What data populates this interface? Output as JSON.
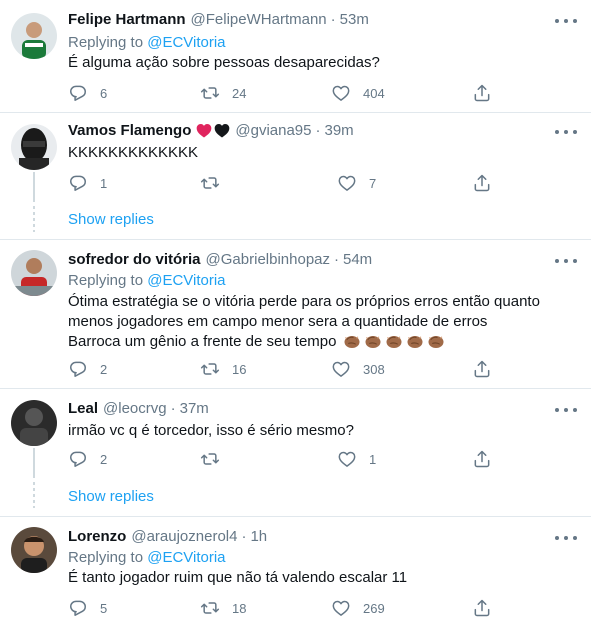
{
  "tweets": [
    {
      "name": "Felipe Hartmann",
      "handle": "@FelipeWHartmann",
      "time": "53m",
      "replying_prefix": "Replying to",
      "replying_to": "@ECVitoria",
      "text_lines": [
        "É alguma ação sobre pessoas desaparecidas?"
      ],
      "replies": "6",
      "retweets": "24",
      "likes": "404"
    },
    {
      "name": "Vamos Flamengo",
      "handle": "@gviana95",
      "time": "39m",
      "text_lines": [
        "KKKKKKKKKKKKK"
      ],
      "replies": "1",
      "retweets": "",
      "likes": "7",
      "show_replies": "Show replies"
    },
    {
      "name": "sofredor do vitória",
      "handle": "@Gabrielbinhopaz",
      "time": "54m",
      "replying_prefix": "Replying to",
      "replying_to": "@ECVitoria",
      "text_lines": [
        "Ótima estratégia se o vitória perde para os próprios erros então quanto",
        "menos jogadores em campo menor sera a quantidade de erros",
        "Barroca um gênio a frente de seu tempo"
      ],
      "replies": "2",
      "retweets": "16",
      "likes": "308"
    },
    {
      "name": "Leal",
      "handle": "@leocrvg",
      "time": "37m",
      "text_lines": [
        "irmão vc q é torcedor, isso é sério mesmo?"
      ],
      "replies": "2",
      "retweets": "",
      "likes": "1",
      "show_replies": "Show replies"
    },
    {
      "name": "Lorenzo",
      "handle": "@araujoznerol4",
      "time": "1h",
      "replying_prefix": "Replying to",
      "replying_to": "@ECVitoria",
      "text_lines": [
        "É tanto jogador ruim que não tá valendo escalar 11"
      ],
      "replies": "5",
      "retweets": "18",
      "likes": "269"
    }
  ],
  "icons": {
    "reply": "reply-icon",
    "retweet": "retweet-icon",
    "like": "heart-icon",
    "share": "share-icon",
    "more": "more-icon",
    "clap": "clapping-hands-emoji"
  },
  "colors": {
    "accent": "#1da1f2",
    "muted": "#657786",
    "text": "#0f1419",
    "divider": "#e1e8ed",
    "heart_red": "#e0245e",
    "heart_black": "#14171a"
  }
}
